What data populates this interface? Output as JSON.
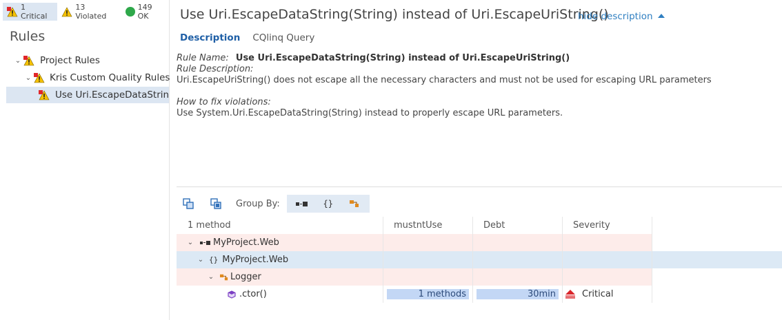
{
  "filters": {
    "critical": "1 Critical",
    "violated": "13 Violated",
    "ok": "149 OK"
  },
  "sidebar": {
    "title": "Rules",
    "items": [
      {
        "label": "Project Rules"
      },
      {
        "label": "Kris Custom Quality Rules"
      },
      {
        "label": "Use Uri.EscapeDataString(S"
      }
    ]
  },
  "header": {
    "title": "Use Uri.EscapeDataString(String) instead of Uri.EscapeUriString()",
    "hide_description": "hide description"
  },
  "tabs": [
    {
      "label": "Description"
    },
    {
      "label": "CQlinq Query"
    }
  ],
  "description": {
    "rule_name_label": "Rule Name:",
    "rule_name": "Use Uri.EscapeDataString(String) instead of Uri.EscapeUriString()",
    "rule_desc_label": "Rule Description:",
    "rule_desc": "Uri.EscapeUriString() does not escape all the necessary characters and must not be used for escaping URL parameters",
    "fix_label": "How to fix violations:",
    "fix_text": "Use System.Uri.EscapeDataString(String) instead to properly escape URL parameters."
  },
  "toolbar": {
    "group_by_label": "Group By:",
    "namespace_glyph": "{}"
  },
  "grid": {
    "columns": [
      "1 method",
      "mustntUse",
      "Debt",
      "Severity"
    ],
    "rows": [
      {
        "label": "MyProject.Web",
        "kind": "assembly"
      },
      {
        "label": "MyProject.Web",
        "kind": "namespace",
        "glyph": "{}"
      },
      {
        "label": "Logger",
        "kind": "type"
      },
      {
        "label": ".ctor()",
        "kind": "method",
        "mustntUse": "1 methods",
        "debt": "30min",
        "severity": "Critical"
      }
    ]
  },
  "colors": {
    "accent": "#2f7fc1",
    "row_pink": "#fdecea",
    "row_blue": "#dce9f5",
    "critical_red": "#d9262b"
  }
}
